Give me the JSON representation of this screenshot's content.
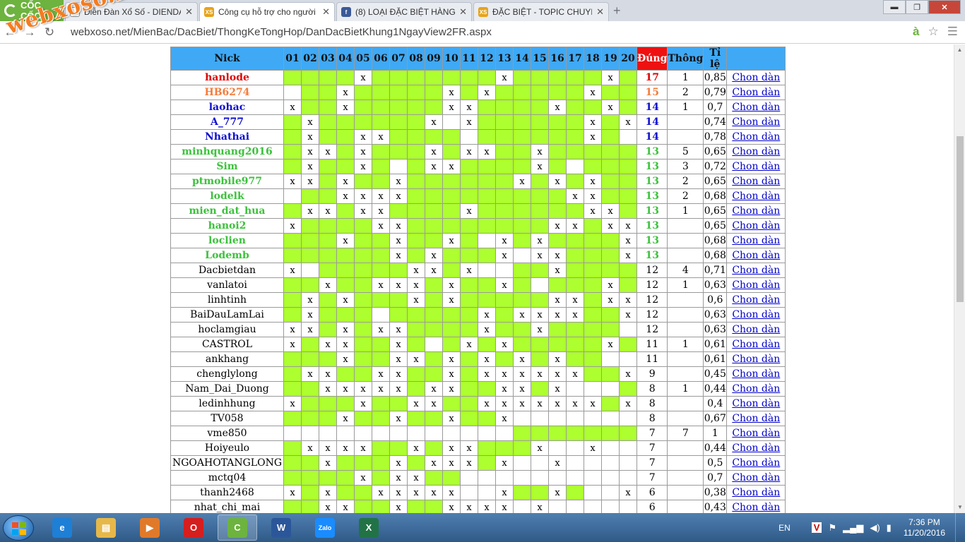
{
  "browser": {
    "brand": "CỐC CỐC",
    "tabs": [
      {
        "label": "Diễn Đàn Xổ Số - DIENDAN",
        "icon": "page-icon",
        "active": false
      },
      {
        "label": "Công cụ hỗ trợ cho người",
        "icon": "xs-icon",
        "active": true
      },
      {
        "label": "(8) LOẠI ĐẶC BIỆT HÀNG N",
        "icon": "facebook-icon",
        "active": false
      },
      {
        "label": "ĐẶC BIỆT - TOPIC CHUYÊN",
        "icon": "xs-icon",
        "active": false
      }
    ],
    "url": "webxoso.net/MienBac/DacBiet/ThongKeTongHop/DanDacBietKhung1NgayView2FR.aspx",
    "translate_label": "à",
    "window_controls": {
      "min": "▬",
      "max": "❐",
      "close": "✕"
    }
  },
  "watermark": "webxoso.net",
  "table": {
    "headers": {
      "nick": "Nick",
      "numbers": [
        "01",
        "02",
        "03",
        "04",
        "05",
        "06",
        "07",
        "08",
        "09",
        "10",
        "11",
        "12",
        "13",
        "14",
        "15",
        "16",
        "17",
        "18",
        "19",
        "20"
      ],
      "dung": "Đúng",
      "thong": "Thông",
      "tile": "Tỉ lệ",
      "chon": ""
    },
    "link_label": "Chon dàn",
    "rows": [
      {
        "nick": "hanlode",
        "color": "red",
        "x": [
          5,
          13,
          19
        ],
        "green": [
          1,
          2,
          3,
          4,
          6,
          7,
          8,
          9,
          10,
          11,
          12,
          14,
          15,
          16,
          17,
          18,
          20
        ],
        "dung": "17",
        "thong": "1",
        "tile": "0,85"
      },
      {
        "nick": "HB6274",
        "color": "orange",
        "x": [
          4,
          10,
          12,
          18
        ],
        "green": [
          2,
          3,
          5,
          6,
          7,
          8,
          9,
          11,
          13,
          14,
          15,
          16,
          17,
          19,
          20
        ],
        "dung": "15",
        "thong": "2",
        "tile": "0,79"
      },
      {
        "nick": "laohac",
        "color": "blue",
        "x": [
          1,
          4,
          10,
          11,
          16,
          19
        ],
        "green": [
          2,
          3,
          5,
          6,
          7,
          8,
          9,
          12,
          13,
          14,
          15,
          17,
          18,
          20
        ],
        "dung": "14",
        "thong": "1",
        "tile": "0,7"
      },
      {
        "nick": "A_777",
        "color": "blue",
        "x": [
          2,
          9,
          11,
          18,
          20
        ],
        "green": [
          1,
          3,
          4,
          5,
          6,
          7,
          8,
          12,
          13,
          14,
          15,
          16,
          17,
          19
        ],
        "dung": "14",
        "thong": "",
        "tile": "0,74"
      },
      {
        "nick": "Nhathai",
        "color": "blue",
        "x": [
          2,
          5,
          6,
          18
        ],
        "green": [
          1,
          3,
          4,
          7,
          8,
          9,
          10,
          12,
          13,
          14,
          15,
          16,
          17,
          19
        ],
        "dung": "14",
        "thong": "",
        "tile": "0,78"
      },
      {
        "nick": "minhquang2016",
        "color": "green",
        "x": [
          2,
          3,
          5,
          9,
          11,
          12,
          15
        ],
        "green": [
          1,
          4,
          6,
          7,
          8,
          10,
          13,
          14,
          16,
          17,
          18,
          19,
          20
        ],
        "dung": "13",
        "thong": "5",
        "tile": "0,65"
      },
      {
        "nick": "Sim",
        "color": "green",
        "x": [
          2,
          5,
          9,
          10,
          15
        ],
        "green": [
          1,
          3,
          4,
          6,
          8,
          11,
          12,
          13,
          14,
          16,
          18,
          19,
          20
        ],
        "dung": "13",
        "thong": "3",
        "tile": "0,72"
      },
      {
        "nick": "ptmobile977",
        "color": "green",
        "x": [
          1,
          2,
          4,
          7,
          14,
          16,
          18
        ],
        "green": [
          3,
          5,
          6,
          8,
          9,
          10,
          11,
          12,
          13,
          15,
          17,
          19,
          20
        ],
        "dung": "13",
        "thong": "2",
        "tile": "0,65"
      },
      {
        "nick": "lodelk",
        "color": "green",
        "x": [
          4,
          5,
          6,
          7,
          17,
          18
        ],
        "green": [
          2,
          3,
          8,
          9,
          10,
          11,
          12,
          13,
          14,
          15,
          16,
          19,
          20
        ],
        "dung": "13",
        "thong": "2",
        "tile": "0,68"
      },
      {
        "nick": "mien_dat_hua",
        "color": "green",
        "x": [
          2,
          3,
          5,
          6,
          11,
          18,
          19
        ],
        "green": [
          1,
          4,
          7,
          8,
          9,
          10,
          12,
          13,
          14,
          15,
          16,
          17,
          20
        ],
        "dung": "13",
        "thong": "1",
        "tile": "0,65"
      },
      {
        "nick": "hanoi2",
        "color": "green",
        "x": [
          1,
          6,
          7,
          16,
          17,
          19,
          20
        ],
        "green": [
          2,
          3,
          4,
          5,
          8,
          9,
          10,
          11,
          12,
          13,
          14,
          15,
          18
        ],
        "dung": "13",
        "thong": "",
        "tile": "0,65"
      },
      {
        "nick": "loclien",
        "color": "green",
        "x": [
          4,
          7,
          10,
          13,
          15,
          20
        ],
        "green": [
          1,
          2,
          3,
          5,
          6,
          8,
          9,
          11,
          14,
          16,
          17,
          18,
          19
        ],
        "dung": "13",
        "thong": "",
        "tile": "0,68"
      },
      {
        "nick": "Lodemb",
        "color": "green",
        "x": [
          7,
          9,
          13,
          15,
          16,
          20
        ],
        "green": [
          1,
          2,
          3,
          4,
          5,
          6,
          8,
          10,
          11,
          12,
          17,
          18,
          19
        ],
        "dung": "13",
        "thong": "",
        "tile": "0,68"
      },
      {
        "nick": "Dacbietdan",
        "color": "black",
        "x": [
          1,
          8,
          9,
          11,
          16
        ],
        "green": [
          3,
          4,
          5,
          6,
          7,
          10,
          14,
          15,
          17,
          18,
          19,
          20
        ],
        "dung": "12",
        "thong": "4",
        "tile": "0,71"
      },
      {
        "nick": "vanlatoi",
        "color": "black",
        "x": [
          3,
          6,
          7,
          8,
          10,
          13,
          19
        ],
        "green": [
          1,
          2,
          4,
          5,
          9,
          11,
          12,
          14,
          16,
          17,
          18,
          20
        ],
        "dung": "12",
        "thong": "1",
        "tile": "0,63"
      },
      {
        "nick": "linhtinh",
        "color": "black",
        "x": [
          2,
          4,
          8,
          10,
          16,
          17,
          19,
          20
        ],
        "green": [
          1,
          3,
          5,
          6,
          7,
          9,
          11,
          12,
          13,
          14,
          15,
          18
        ],
        "dung": "12",
        "thong": "",
        "tile": "0,6"
      },
      {
        "nick": "BaiDauLamLai",
        "color": "black",
        "x": [
          2,
          12,
          14,
          15,
          16,
          17,
          20
        ],
        "green": [
          1,
          3,
          4,
          5,
          7,
          8,
          9,
          10,
          11,
          13,
          18,
          19
        ],
        "dung": "12",
        "thong": "",
        "tile": "0,63"
      },
      {
        "nick": "hoclamgiau",
        "color": "black",
        "x": [
          1,
          2,
          4,
          6,
          7,
          12,
          15
        ],
        "green": [
          3,
          5,
          8,
          9,
          10,
          11,
          13,
          14,
          16,
          17,
          18,
          19
        ],
        "dung": "12",
        "thong": "",
        "tile": "0,63"
      },
      {
        "nick": "CASTROL",
        "color": "black",
        "x": [
          1,
          3,
          4,
          7,
          11,
          13,
          19
        ],
        "green": [
          2,
          5,
          6,
          8,
          10,
          12,
          14,
          15,
          16,
          17,
          18,
          20
        ],
        "dung": "11",
        "thong": "1",
        "tile": "0,61"
      },
      {
        "nick": "ankhang",
        "color": "black",
        "x": [
          4,
          7,
          8,
          10,
          12,
          14,
          16
        ],
        "green": [
          1,
          2,
          3,
          5,
          6,
          9,
          11,
          13,
          15,
          17,
          18
        ],
        "dung": "11",
        "thong": "",
        "tile": "0,61"
      },
      {
        "nick": "chenglylong",
        "color": "black",
        "x": [
          2,
          3,
          6,
          7,
          10,
          12,
          13,
          14,
          15,
          16,
          17,
          20
        ],
        "green": [
          1,
          4,
          5,
          8,
          9,
          11,
          18,
          19
        ],
        "dung": "9",
        "thong": "",
        "tile": "0,45"
      },
      {
        "nick": "Nam_Dai_Duong",
        "color": "black",
        "x": [
          3,
          4,
          5,
          6,
          7,
          9,
          10,
          13,
          14,
          16
        ],
        "green": [
          1,
          2,
          8,
          11,
          12,
          15,
          20
        ],
        "dung": "8",
        "thong": "1",
        "tile": "0,44"
      },
      {
        "nick": "ledinhhung",
        "color": "black",
        "x": [
          1,
          5,
          8,
          9,
          12,
          13,
          14,
          15,
          16,
          17,
          18,
          20
        ],
        "green": [
          2,
          3,
          4,
          6,
          7,
          10,
          11,
          19
        ],
        "dung": "8",
        "thong": "",
        "tile": "0,4"
      },
      {
        "nick": "TV058",
        "color": "black",
        "x": [
          4,
          7,
          10,
          13
        ],
        "green": [
          1,
          2,
          3,
          5,
          6,
          8,
          9,
          11,
          12
        ],
        "dung": "8",
        "thong": "",
        "tile": "0,67"
      },
      {
        "nick": "vme850",
        "color": "black",
        "x": [],
        "green": [
          14,
          15,
          16,
          17,
          18,
          19,
          20
        ],
        "dung": "7",
        "thong": "7",
        "tile": "1"
      },
      {
        "nick": "Hoiyeulo",
        "color": "black",
        "x": [
          2,
          3,
          4,
          5,
          8,
          10,
          11,
          15,
          18
        ],
        "green": [
          1,
          6,
          7,
          9,
          12,
          13,
          14
        ],
        "dung": "7",
        "thong": "",
        "tile": "0,44"
      },
      {
        "nick": "NGOAHOTANGLONG",
        "color": "black",
        "x": [
          3,
          7,
          9,
          10,
          11,
          13,
          16
        ],
        "green": [
          1,
          2,
          4,
          5,
          6,
          8,
          12
        ],
        "dung": "7",
        "thong": "",
        "tile": "0,5"
      },
      {
        "nick": "mctq04",
        "color": "black",
        "x": [
          5,
          7,
          8
        ],
        "green": [
          1,
          2,
          3,
          4,
          6,
          9,
          10
        ],
        "dung": "7",
        "thong": "",
        "tile": "0,7"
      },
      {
        "nick": "thanh2468",
        "color": "black",
        "x": [
          1,
          3,
          6,
          7,
          8,
          9,
          10,
          13,
          16,
          20
        ],
        "green": [
          2,
          4,
          5,
          14,
          15,
          17
        ],
        "dung": "6",
        "thong": "",
        "tile": "0,38"
      },
      {
        "nick": "nhat_chi_mai",
        "color": "black",
        "x": [
          3,
          4,
          7,
          10,
          11,
          12,
          13,
          15
        ],
        "green": [
          1,
          2,
          5,
          6,
          8,
          9
        ],
        "dung": "6",
        "thong": "",
        "tile": "0,43"
      }
    ]
  },
  "taskbar": {
    "apps": [
      {
        "name": "internet-explorer",
        "label": "e",
        "color": "#1e7fd6"
      },
      {
        "name": "file-explorer",
        "label": "▤",
        "color": "#e6b84a"
      },
      {
        "name": "media-player",
        "label": "▶",
        "color": "#e07a2a"
      },
      {
        "name": "opera",
        "label": "O",
        "color": "#d51e1e"
      },
      {
        "name": "coccoc-browser",
        "label": "C",
        "color": "#6db33f"
      },
      {
        "name": "word",
        "label": "W",
        "color": "#2b579a"
      },
      {
        "name": "zalo",
        "label": "Zalo",
        "color": "#1a8cff"
      },
      {
        "name": "excel",
        "label": "X",
        "color": "#217346"
      }
    ],
    "lang": "EN",
    "time": "7:36 PM",
    "date": "11/20/2016"
  }
}
